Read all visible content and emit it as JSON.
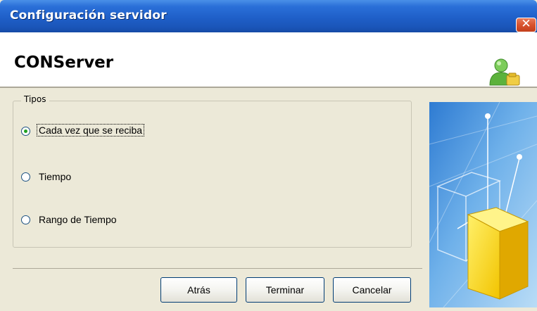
{
  "window": {
    "title": "Configuración servidor",
    "close_glyph": "✕"
  },
  "header": {
    "title": "CONServer",
    "icon": "user-config-icon"
  },
  "group": {
    "label": "Tipos",
    "options": [
      {
        "label": "Cada vez que se reciba",
        "selected": true
      },
      {
        "label": "Tiempo",
        "selected": false
      },
      {
        "label": "Rango de Tiempo",
        "selected": false
      }
    ]
  },
  "buttons": {
    "back": "Atrás",
    "finish": "Terminar",
    "cancel": "Cancelar"
  },
  "colors": {
    "titlebar": "#1f5fc8",
    "radio_dot": "#21a121",
    "cube": "#f7d200"
  }
}
